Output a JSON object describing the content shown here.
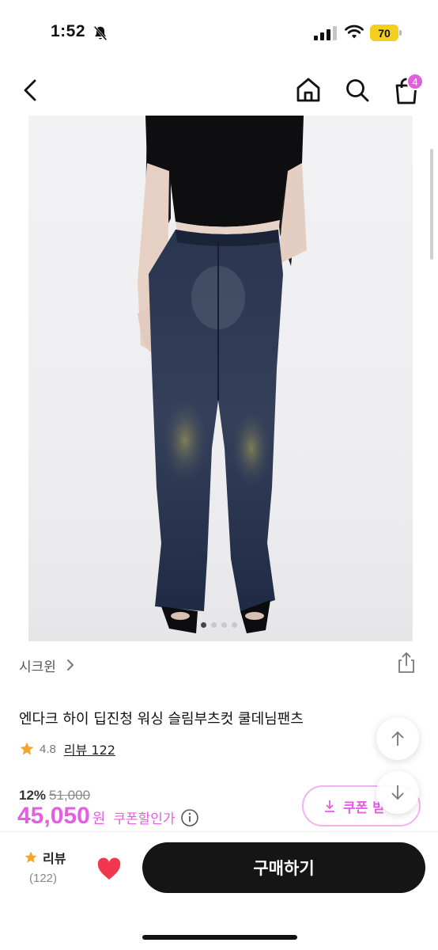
{
  "status_bar": {
    "time": "1:52",
    "battery": "70",
    "colors": {
      "battery": "#f5cf1f"
    }
  },
  "nav": {
    "icons": [
      "back-icon",
      "home-icon",
      "search-icon",
      "cart-icon"
    ],
    "cart_count": "4",
    "colors": {
      "badge": "#e05fe0"
    }
  },
  "gallery": {
    "image_count": 4,
    "active_index": 0
  },
  "product": {
    "seller": "시크윈",
    "title": "엔다크 하이 딥진청 워싱 슬림부츠컷 쿨데님팬츠",
    "rating": "4.8",
    "review_link": "리뷰 122",
    "discount": "12%",
    "original_price": "51,000",
    "sale_price": "45,050",
    "currency": "원",
    "coupon_text": "쿠폰할인가",
    "coupon_button": "쿠폰 받",
    "colors": {
      "accent": "#e35fe0",
      "star": "#f3a62b"
    }
  },
  "bottom_bar": {
    "review_label": "리뷰",
    "review_count": "(122)",
    "buy_label": "구매하기",
    "colors": {
      "heart": "#f0374d",
      "buy_bg": "#151515"
    }
  }
}
